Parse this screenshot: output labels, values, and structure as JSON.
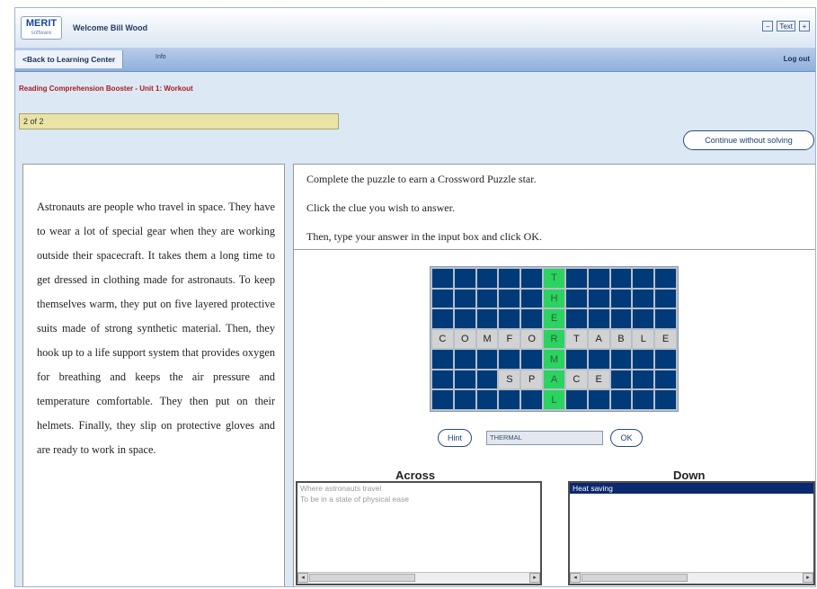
{
  "header": {
    "logo_text": "MERIT",
    "logo_sub": "software",
    "welcome": "Welcome Bill Wood",
    "window_buttons": [
      "−",
      "Text",
      "+"
    ]
  },
  "nav": {
    "back_label": "<Back to Learning Center",
    "info_label": "Info",
    "logout_label": "Log out"
  },
  "breadcrumb": "Reading Comprehension Booster - Unit 1: Workout",
  "progress_text": "2 of 2",
  "continue_label": "Continue without solving",
  "reading_text": "Astronauts are people who travel in space. They have to wear a lot of special gear when they are working outside their spacecraft. It takes them a long time to get dressed in clothing made for astronauts. To keep themselves warm, they put on five layered protective suits made of strong synthetic material. Then, they hook up to a life support system that provides oxygen for breathing and keeps the air pressure and temperature comfortable. They then put on their helmets. Finally, they slip on protective gloves and are ready to work in space.",
  "instructions": {
    "line1": "Complete the puzzle to earn a Crossword Puzzle star.",
    "line2": "Click the clue you wish to answer.",
    "line3": "Then, type your answer in the input box and click OK."
  },
  "crossword": {
    "rows": [
      [
        "",
        "",
        "",
        "",
        "",
        "T",
        "",
        "",
        "",
        "",
        ""
      ],
      [
        "",
        "",
        "",
        "",
        "",
        "H",
        "",
        "",
        "",
        "",
        ""
      ],
      [
        "",
        "",
        "",
        "",
        "",
        "E",
        "",
        "",
        "",
        "",
        ""
      ],
      [
        "C",
        "O",
        "M",
        "F",
        "O",
        "R",
        "T",
        "A",
        "B",
        "L",
        "E"
      ],
      [
        "",
        "",
        "",
        "",
        "",
        "M",
        "",
        "",
        "",
        "",
        ""
      ],
      [
        "",
        "",
        "",
        "S",
        "P",
        "A",
        "C",
        "E",
        "",
        "",
        ""
      ],
      [
        "",
        "",
        "",
        "",
        "",
        "L",
        "",
        "",
        "",
        "",
        ""
      ]
    ],
    "active_column": 5
  },
  "controls": {
    "hint_label": "Hint",
    "answer_value": "THERMAL",
    "ok_label": "OK"
  },
  "across": {
    "title": "Across",
    "clues": [
      "Where astronauts travel",
      "To be in a state of physical ease"
    ]
  },
  "down": {
    "title": "Down",
    "clues": [
      "Heat saving"
    ],
    "selected_index": 0
  },
  "colors": {
    "grid_blank": "#003a78",
    "grid_active": "#2bd35f",
    "selection": "#0b2970",
    "breadcrumb": "#a51d1d"
  }
}
